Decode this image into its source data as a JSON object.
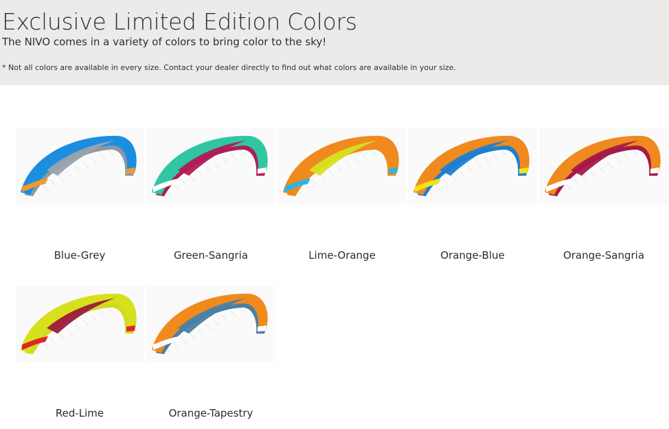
{
  "header": {
    "title": "Exclusive Limited Edition Colors",
    "subtitle": "The NIVO comes in a variety of colors to bring color to the sky!",
    "note": "* Not all colors are available in every size. Contact your dealer directly to find out what colors are available in your size."
  },
  "swatches": [
    {
      "label": "Blue-Grey",
      "colors": {
        "top": "#1c8ee0",
        "stripe": "#9aa3ad",
        "under": "#8f98a2",
        "accent": "#f39a2a",
        "accent2": "#f39a2a"
      }
    },
    {
      "label": "Green-Sangria",
      "colors": {
        "top": "#2fc6a3",
        "stripe": "#b01c55",
        "under": "#b01c55",
        "accent": "#ffffff",
        "accent2": "#ffffff"
      }
    },
    {
      "label": "Lime-Orange",
      "colors": {
        "top": "#f08a1e",
        "stripe": "#d8e21d",
        "under": "#f08a1e",
        "accent": "#29b6e8",
        "accent2": "#29b6e8"
      }
    },
    {
      "label": "Orange-Blue",
      "colors": {
        "top": "#f08a1e",
        "stripe": "#1c7fd0",
        "under": "#1c7fd0",
        "accent": "#f2e21a",
        "accent2": "#f2e21a"
      }
    },
    {
      "label": "Orange-Sangria",
      "colors": {
        "top": "#f08a1e",
        "stripe": "#a4184a",
        "under": "#a4184a",
        "accent": "#ffffff",
        "accent2": "#ffffff"
      }
    },
    {
      "label": "Red-Lime",
      "colors": {
        "top": "#d6e01c",
        "stripe": "#9b1a3c",
        "under": "#cfdc1c",
        "accent": "#e0242b",
        "accent2": "#e0242b"
      }
    },
    {
      "label": "Orange-Tapestry",
      "colors": {
        "top": "#f08a1e",
        "stripe": "#4a7fa6",
        "under": "#4a7fa6",
        "accent": "#ffffff",
        "accent2": "#ffffff"
      }
    }
  ]
}
